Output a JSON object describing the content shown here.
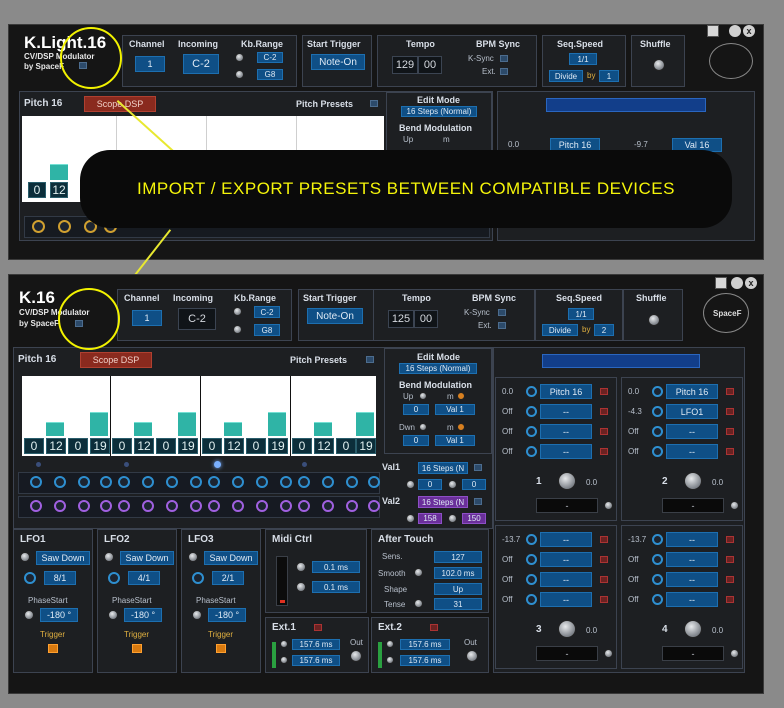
{
  "top": {
    "title": "K.Light.16",
    "subtitle1": "CV/DSP Modulator",
    "subtitle2": "by SpaceF",
    "channel_label": "Channel",
    "channel_value": "1",
    "incoming_label": "Incoming",
    "incoming_value": "C-2",
    "kbrange_label": "Kb.Range",
    "kbrange_low": "C-2",
    "kbrange_high": "G8",
    "start_trigger_label": "Start Trigger",
    "start_trigger_value": "Note-On",
    "tempo_label": "Tempo",
    "tempo_a": "129",
    "tempo_b": "00",
    "bpm_sync_label": "BPM Sync",
    "ksync_label": "K-Sync",
    "ext_label": "Ext.",
    "seq_speed_label": "Seq.Speed",
    "seq_speed_value": "1/1",
    "divide_label": "Divide",
    "by_label": "by",
    "divide_value": "1",
    "shuffle_label": "Shuffle",
    "pitch_label": "Pitch 16",
    "scope_dsp": "Scope DSP",
    "pitch_presets": "Pitch Presets",
    "edit_mode_label": "Edit Mode",
    "edit_mode_value": "16 Steps (Normal)",
    "bend_mod_label": "Bend Modulation",
    "up_label": "Up",
    "m_label": "m",
    "steps": [
      "0",
      "12"
    ],
    "mod_a_val": "0.0",
    "mod_a_dest": "Pitch 16",
    "mod_b_val": "-9.7",
    "mod_b_dest": "Val 16"
  },
  "banner": "IMPORT / EXPORT PRESETS BETWEEN COMPATIBLE DEVICES",
  "bottom": {
    "title": "K.16",
    "subtitle1": "CV/DSP Modulator",
    "subtitle2": "by SpaceF",
    "brand": "SpaceF",
    "channel_label": "Channel",
    "channel_value": "1",
    "incoming_label": "Incoming",
    "incoming_value": "C-2",
    "kbrange_label": "Kb.Range",
    "kbrange_low": "C-2",
    "kbrange_high": "G8",
    "start_trigger_label": "Start Trigger",
    "start_trigger_value": "Note-On",
    "tempo_label": "Tempo",
    "tempo_a": "125",
    "tempo_b": "00",
    "bpm_sync_label": "BPM Sync",
    "ksync_label": "K-Sync",
    "ext_label": "Ext.",
    "seq_speed_label": "Seq.Speed",
    "seq_speed_value": "1/1",
    "divide_label": "Divide",
    "by_label": "by",
    "divide_value": "2",
    "shuffle_label": "Shuffle",
    "pitch_label": "Pitch 16",
    "scope_dsp": "Scope DSP",
    "pitch_presets": "Pitch Presets",
    "edit_mode_label": "Edit Mode",
    "edit_mode_value": "16 Steps (Normal)",
    "bend_mod_label": "Bend Modulation",
    "up_label": "Up",
    "dwn_label": "Dwn",
    "m_label": "m",
    "up_a": "0",
    "up_b": "Val 1",
    "dwn_a": "0",
    "dwn_b": "Val 1",
    "steps": [
      "0",
      "12",
      "0",
      "19",
      "0",
      "12",
      "0",
      "19",
      "0",
      "12",
      "0",
      "19",
      "0",
      "12",
      "0",
      "19"
    ],
    "val1_label": "Val1",
    "val1_mode": "16 Steps (N",
    "val1_a": "0",
    "val1_b": "0",
    "val2_label": "Val2",
    "val2_mode": "16 Steps (N",
    "val2_a": "158",
    "val2_b": "150",
    "lfo": [
      {
        "label": "LFO1",
        "wave": "Saw Down",
        "rate": "8/1",
        "phase_label": "PhaseStart",
        "phase": "-180 °",
        "trigger": "Trigger"
      },
      {
        "label": "LFO2",
        "wave": "Saw Down",
        "rate": "4/1",
        "phase_label": "PhaseStart",
        "phase": "-180 °",
        "trigger": "Trigger"
      },
      {
        "label": "LFO3",
        "wave": "Saw Down",
        "rate": "2/1",
        "phase_label": "PhaseStart",
        "phase": "-180 °",
        "trigger": "Trigger"
      }
    ],
    "midi_ctrl_label": "Midi Ctrl",
    "midi_a": "0.1 ms",
    "midi_b": "0.1 ms",
    "after_touch_label": "After Touch",
    "sens_label": "Sens.",
    "sens_value": "127",
    "smooth_label": "Smooth",
    "smooth_value": "102.0 ms",
    "shape_label": "Shape",
    "shape_value": "Up",
    "tense_label": "Tense",
    "tense_value": "31",
    "ext1_label": "Ext.1",
    "ext1_a": "157.6 ms",
    "ext1_b": "157.6 ms",
    "ext2_label": "Ext.2",
    "ext2_a": "157.6 ms",
    "ext2_b": "157.6 ms",
    "out_label": "Out",
    "mod_panels": [
      {
        "id": "1",
        "knob_val": "0.0",
        "rows": [
          {
            "amt": "0.0",
            "dest": "Pitch 16"
          },
          {
            "amt": "Off",
            "dest": "--"
          },
          {
            "amt": "Off",
            "dest": "--"
          },
          {
            "amt": "Off",
            "dest": "--"
          }
        ],
        "out": "-"
      },
      {
        "id": "2",
        "knob_val": "0.0",
        "rows": [
          {
            "amt": "0.0",
            "dest": "Pitch 16"
          },
          {
            "amt": "-4.3",
            "dest": "LFO1"
          },
          {
            "amt": "Off",
            "dest": "--"
          },
          {
            "amt": "Off",
            "dest": "--"
          }
        ],
        "out": "-"
      },
      {
        "id": "3",
        "knob_val": "0.0",
        "rows": [
          {
            "amt": "-13.7",
            "dest": "--"
          },
          {
            "amt": "Off",
            "dest": "--"
          },
          {
            "amt": "Off",
            "dest": "--"
          },
          {
            "amt": "Off",
            "dest": "--"
          }
        ],
        "out": "-"
      },
      {
        "id": "4",
        "knob_val": "0.0",
        "rows": [
          {
            "amt": "-13.7",
            "dest": "--"
          },
          {
            "amt": "Off",
            "dest": "--"
          },
          {
            "amt": "Off",
            "dest": "--"
          },
          {
            "amt": "Off",
            "dest": "--"
          }
        ],
        "out": "-"
      }
    ]
  },
  "colors": {
    "accent": "#1d6fb0",
    "teal": "#2fb4a6",
    "highlight": "#f2f200",
    "panel": "#151515"
  }
}
